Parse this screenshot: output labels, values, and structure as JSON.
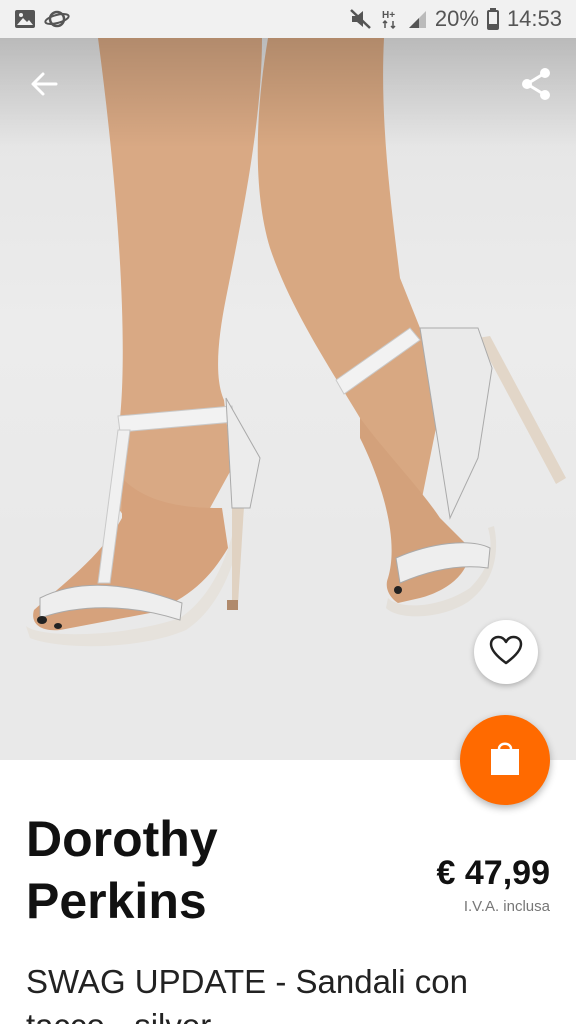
{
  "status_bar": {
    "battery_percent": "20%",
    "time": "14:53",
    "network": "H+"
  },
  "product": {
    "brand": "Dorothy Perkins",
    "price": "€ 47,99",
    "vat_note": "I.V.A. inclusa",
    "name": "SWAG UPDATE - Sandali con tacco - silver"
  },
  "colors": {
    "accent": "#ff6a00",
    "status_bar_bg": "#f1f1f1"
  },
  "icons": {
    "back": "arrow-left-icon",
    "share": "share-icon",
    "favorite": "heart-outline-icon",
    "cart": "shopping-bag-icon"
  }
}
